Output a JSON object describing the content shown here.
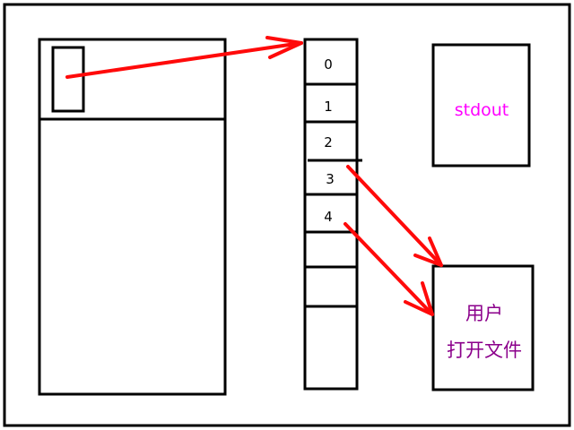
{
  "colors": {
    "stroke": "#000000",
    "arrow": "#ff0a0a",
    "stdout_text": "#ff00ff",
    "file_text": "#8b008b",
    "background": "#ffffff"
  },
  "fd_table": {
    "slots": [
      "0",
      "1",
      "2",
      "3",
      "4",
      "",
      "",
      ""
    ]
  },
  "stdout_box": {
    "label": "stdout"
  },
  "file_box": {
    "line1": "用户",
    "line2": "打开文件"
  }
}
